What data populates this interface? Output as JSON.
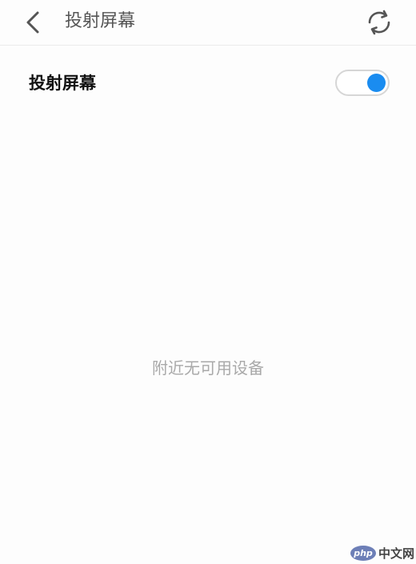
{
  "header": {
    "title": "投射屏幕",
    "back_icon": "chevron-left-icon",
    "refresh_icon": "refresh-icon"
  },
  "setting": {
    "label": "投射屏幕",
    "toggle_on": true,
    "toggle_color": "#1a8cf0"
  },
  "empty_state": {
    "message": "附近无可用设备"
  },
  "watermark": {
    "badge": "php",
    "text": "中文网"
  }
}
